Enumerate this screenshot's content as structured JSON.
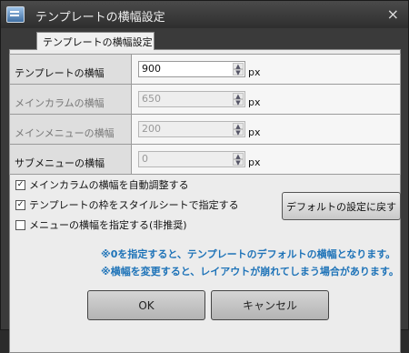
{
  "window": {
    "title": "テンプレートの横幅設定",
    "close_label": "×"
  },
  "tab": {
    "label": "テンプレートの横幅設定"
  },
  "rows": [
    {
      "label": "テンプレートの横幅",
      "value": "900",
      "unit": "px",
      "enabled": true
    },
    {
      "label": "メインカラムの横幅",
      "value": "650",
      "unit": "px",
      "enabled": false
    },
    {
      "label": "メインメニューの横幅",
      "value": "200",
      "unit": "px",
      "enabled": false
    },
    {
      "label": "サブメニューの横幅",
      "value": "0",
      "unit": "px",
      "enabled": false
    }
  ],
  "checkboxes": [
    {
      "label": "メインカラムの横幅を自動調整する",
      "checked": true
    },
    {
      "label": "テンプレートの枠をスタイルシートで指定する",
      "checked": true
    },
    {
      "label": "メニューの横幅を指定する(非推奨)",
      "checked": false
    }
  ],
  "default_button": {
    "label": "デフォルトの設定に戻す"
  },
  "notes": [
    "※0を指定すると、テンプレートのデフォルトの横幅となります。",
    "※横幅を変更すると、レイアウトが崩れてしまう場合があります。"
  ],
  "footer": {
    "ok_label": "OK",
    "cancel_label": "キャンセル"
  },
  "icons": {
    "app": "app-window-icon",
    "close": "close-icon",
    "check": "✓",
    "spin_up": "▲",
    "spin_down": "▼"
  }
}
